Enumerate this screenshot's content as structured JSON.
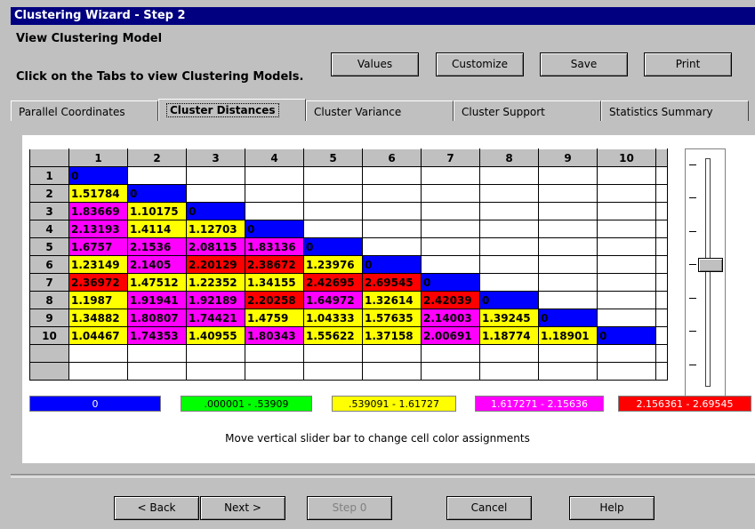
{
  "window": {
    "title": "Clustering Wizard - Step 2"
  },
  "header": {
    "subtitle": "View Clustering Model",
    "instruction": "Click on the Tabs to view Clustering Models."
  },
  "toolbar": {
    "values": "Values",
    "customize": "Customize",
    "save": "Save",
    "print": "Print"
  },
  "tabs": [
    "Parallel Coordinates",
    "Cluster Distances",
    "Cluster Variance",
    "Cluster Support",
    "Statistics Summary"
  ],
  "active_tab": "Cluster Distances",
  "matrix": {
    "col_headers": [
      "1",
      "2",
      "3",
      "4",
      "5",
      "6",
      "7",
      "8",
      "9",
      "10"
    ],
    "rows": [
      {
        "label": "1",
        "cells": [
          "0"
        ]
      },
      {
        "label": "2",
        "cells": [
          "1.51784",
          "0"
        ]
      },
      {
        "label": "3",
        "cells": [
          "1.83669",
          "1.10175",
          "0"
        ]
      },
      {
        "label": "4",
        "cells": [
          "2.13193",
          "1.4114",
          "1.12703",
          "0"
        ]
      },
      {
        "label": "5",
        "cells": [
          "1.6757",
          "2.1536",
          "2.08115",
          "1.83136",
          "0"
        ]
      },
      {
        "label": "6",
        "cells": [
          "1.23149",
          "2.1405",
          "2.20129",
          "2.38672",
          "1.23976",
          "0"
        ]
      },
      {
        "label": "7",
        "cells": [
          "2.36972",
          "1.47512",
          "1.22352",
          "1.34155",
          "2.42695",
          "2.69545",
          "0"
        ]
      },
      {
        "label": "8",
        "cells": [
          "1.1987",
          "1.91941",
          "1.92189",
          "2.20258",
          "1.64972",
          "1.32614",
          "2.42039",
          "0"
        ]
      },
      {
        "label": "9",
        "cells": [
          "1.34882",
          "1.80807",
          "1.74421",
          "1.4759",
          "1.04333",
          "1.57635",
          "2.14003",
          "1.39245",
          "0"
        ]
      },
      {
        "label": "10",
        "cells": [
          "1.04467",
          "1.74353",
          "1.40955",
          "1.80343",
          "1.55622",
          "1.37158",
          "2.00691",
          "1.18774",
          "1.18901",
          "0"
        ]
      }
    ]
  },
  "legend": [
    {
      "label": "0",
      "color": "#0000ff",
      "text_color": "#ffffff"
    },
    {
      "label": ".000001 - .53909",
      "color": "#00ff00",
      "text_color": "#000000"
    },
    {
      "label": ".539091 - 1.61727",
      "color": "#ffff00",
      "text_color": "#000000"
    },
    {
      "label": "1.617271 - 2.15636",
      "color": "#ff00ff",
      "text_color": "#ffffff"
    },
    {
      "label": "2.156361 - 2.69545",
      "color": "#ff0000",
      "text_color": "#ffffff"
    }
  ],
  "slider_hint": "Move vertical slider bar to change cell color assignments",
  "footer": {
    "back": "< Back",
    "next": "Next >",
    "step0": "Step 0",
    "cancel": "Cancel",
    "help": "Help"
  }
}
